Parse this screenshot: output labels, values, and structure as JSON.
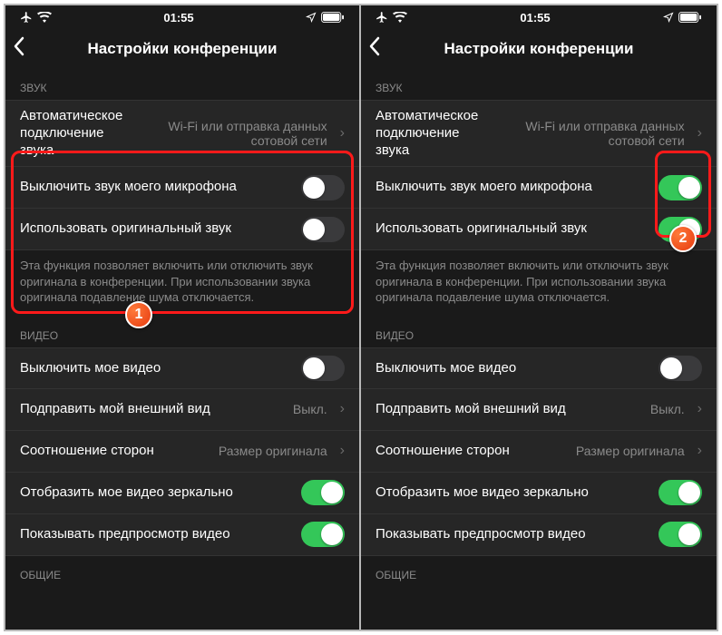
{
  "status": {
    "time": "01:55"
  },
  "header": {
    "title": "Настройки конференции"
  },
  "sections": {
    "sound": "ЗВУК",
    "video": "ВИДЕО",
    "general": "ОБЩИЕ"
  },
  "rows": {
    "auto_audio": {
      "label": "Автоматическое подключение звука",
      "value": "Wi-Fi или отправка данных сотовой сети"
    },
    "mute_mic": {
      "label": "Выключить звук моего микрофона"
    },
    "orig_sound": {
      "label": "Использовать оригинальный звук"
    },
    "orig_desc": "Эта функция позволяет включить или отключить звук оригинала в конференции. При использовании звука оригинала подавление шума отключается.",
    "video_off": {
      "label": "Выключить мое видео"
    },
    "touch_up": {
      "label": "Подправить мой внешний вид",
      "value": "Выкл."
    },
    "aspect": {
      "label": "Соотношение сторон",
      "value": "Размер оригинала"
    },
    "mirror": {
      "label": "Отобразить мое видео зеркально"
    },
    "preview": {
      "label": "Показывать предпросмотр видео"
    }
  },
  "badges": {
    "one": "1",
    "two": "2"
  }
}
